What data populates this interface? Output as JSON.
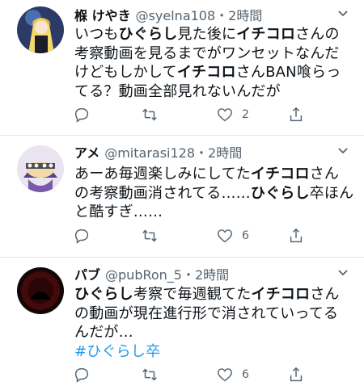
{
  "tweets": [
    {
      "name": "椺 けやき",
      "handle": "@syelna108",
      "time": "・2時間",
      "lines": [
        [
          {
            "t": "いつも"
          },
          {
            "t": "ひぐらし",
            "b": true
          },
          {
            "t": "見た後に"
          },
          {
            "t": "イチコロ",
            "b": true
          },
          {
            "t": "さんの"
          }
        ],
        [
          {
            "t": "考察動画を見るまでがワンセットなんだ"
          }
        ],
        [
          {
            "t": "けどもしかして"
          },
          {
            "t": "イチコロ",
            "b": true
          },
          {
            "t": "さんBAN喰らっ"
          }
        ],
        [
          {
            "t": "てる？動画全部見れないんだが"
          }
        ]
      ],
      "reply_count": "",
      "retweet_count": "",
      "like_count": "2"
    },
    {
      "name": "アメ",
      "handle": "@mitarasi128",
      "time": "・2時間",
      "lines": [
        [
          {
            "t": "あーあ毎週楽しみにしてた"
          },
          {
            "t": "イチコロ",
            "b": true
          },
          {
            "t": "さん"
          }
        ],
        [
          {
            "t": "の考察動画消されてる……"
          },
          {
            "t": "ひぐらし",
            "b": true
          },
          {
            "t": "卒ほん"
          }
        ],
        [
          {
            "t": "と酷すぎ……"
          }
        ]
      ],
      "reply_count": "",
      "retweet_count": "",
      "like_count": "6"
    },
    {
      "name": "パブ",
      "handle": "@pubRon_5",
      "time": "・2時間",
      "lines": [
        [
          {
            "t": "ひぐらし",
            "b": true
          },
          {
            "t": "考察で毎週観てた"
          },
          {
            "t": "イチコロ",
            "b": true
          },
          {
            "t": "さん"
          }
        ],
        [
          {
            "t": "の動画が現在進行形で消されていってる"
          }
        ],
        [
          {
            "t": "んだが…"
          }
        ],
        [
          {
            "t": "#ひぐらし卒",
            "h": true
          }
        ]
      ],
      "reply_count": "",
      "retweet_count": "",
      "like_count": "6"
    }
  ],
  "icons": {
    "caret": "chevron-down-icon",
    "reply": "reply-icon",
    "retweet": "retweet-icon",
    "like": "like-icon",
    "share": "share-icon"
  },
  "colors": {
    "text": "#0f1419",
    "secondary": "#536471",
    "hashtag": "#1d9bf0",
    "divider": "#e1e6ea"
  }
}
